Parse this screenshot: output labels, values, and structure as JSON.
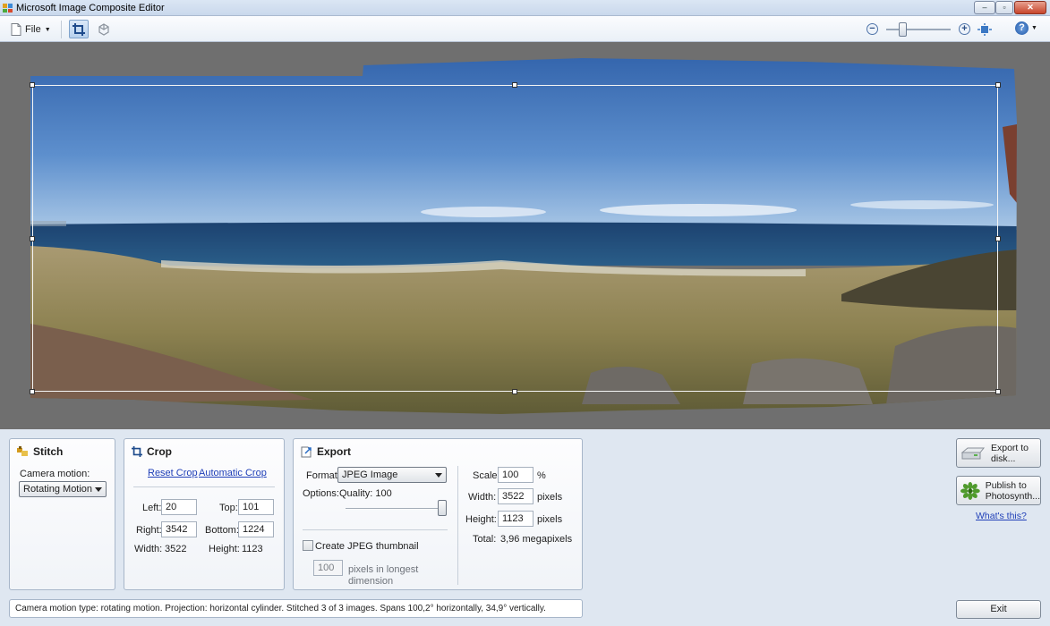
{
  "window": {
    "title": "Microsoft Image Composite Editor",
    "minimize": "–",
    "maximize": "▫",
    "close": "✕"
  },
  "toolbar": {
    "file_label": "File",
    "zoom_minus": "−",
    "zoom_plus": "+",
    "help": "?"
  },
  "stitch": {
    "title": "Stitch",
    "camera_motion_label": "Camera motion:",
    "camera_motion_value": "Rotating Motion"
  },
  "crop": {
    "title": "Crop",
    "reset_label": "Reset Crop",
    "auto_label": "Automatic Crop",
    "left_label": "Left:",
    "left_value": "20",
    "top_label": "Top:",
    "top_value": "101",
    "right_label": "Right:",
    "right_value": "3542",
    "bottom_label": "Bottom:",
    "bottom_value": "1224",
    "width_label": "Width:",
    "width_value": "3522",
    "height_label": "Height:",
    "height_value": "1123"
  },
  "export": {
    "title": "Export",
    "format_label": "Format:",
    "format_value": "JPEG Image",
    "options_label": "Options:",
    "quality_label": "Quality: 100",
    "quality": 100,
    "thumbnail_label": "Create JPEG thumbnail",
    "thumbnail_size": "100",
    "thumbnail_unit_line1": "pixels in longest",
    "thumbnail_unit_line2": "dimension",
    "scale_label": "Scale:",
    "scale_value": "100",
    "scale_unit": "%",
    "width_label": "Width:",
    "width_value": "3522",
    "width_unit": "pixels",
    "height_label": "Height:",
    "height_value": "1123",
    "height_unit": "pixels",
    "total_label": "Total:",
    "total_value": "3,96 megapixels"
  },
  "actions": {
    "export_disk_line1": "Export to",
    "export_disk_line2": "disk...",
    "publish_line1": "Publish to",
    "publish_line2": "Photosynth...",
    "whats_this": "What's this?",
    "exit": "Exit"
  },
  "status": {
    "text": "Camera motion type: rotating motion. Projection: horizontal cylinder. Stitched 3 of 3 images. Spans 100,2° horizontally, 34,9° vertically."
  }
}
